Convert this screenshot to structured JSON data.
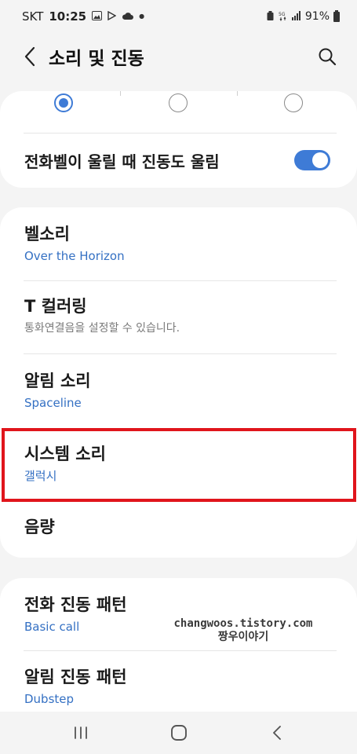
{
  "status_bar": {
    "carrier": "SKT",
    "time": "10:25",
    "battery_text": "91%"
  },
  "header": {
    "title": "소리 및 진동"
  },
  "sound_mode": {
    "vibrate_when_ringing_label": "전화벨이 울릴 때 진동도 울림",
    "vibrate_when_ringing": true
  },
  "sound_settings": {
    "items": [
      {
        "title": "벨소리",
        "subtitle": "Over the Horizon"
      },
      {
        "title": "T 컬러링",
        "subtitle": "통화연결음을 설정할 수 있습니다."
      },
      {
        "title": "알림 소리",
        "subtitle": "Spaceline"
      },
      {
        "title": "시스템 소리",
        "subtitle": "갤럭시"
      },
      {
        "title": "음량"
      }
    ]
  },
  "vibration_settings": {
    "items": [
      {
        "title": "전화 진동 패턴",
        "subtitle": "Basic call"
      },
      {
        "title": "알림 진동 패턴",
        "subtitle": "Dubstep"
      }
    ]
  },
  "watermark": {
    "line1": "changwoos.tistory.com",
    "line2": "짱우이야기"
  },
  "colors": {
    "accent": "#3e7bd6",
    "subtitle_link": "#3470c3",
    "highlight": "#e0151c"
  }
}
